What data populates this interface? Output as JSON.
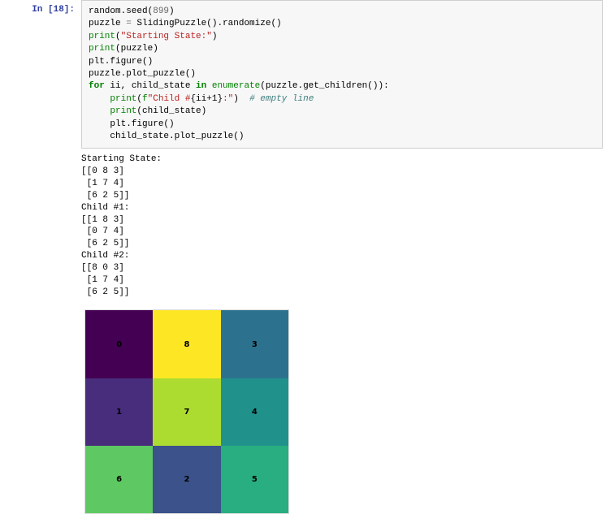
{
  "cell": {
    "in_prompt": "In [18]:",
    "run_btn_glyph": "▶",
    "code": {
      "l0_fn": "random",
      "l0_call": ".seed(",
      "l0_num": "899",
      "l0_end": ")",
      "l1": "puzzle ",
      "l1_eq": "=",
      "l1_rest": " SlidingPuzzle().randomize()",
      "l2_print": "print",
      "l2_arg": "\"Starting State:\"",
      "l3_print": "print",
      "l3_arg": "(puzzle)",
      "l4": "plt.figure()",
      "l5": "puzzle.plot_puzzle()",
      "l6_for": "for",
      "l6_mid": " ii, child_state ",
      "l6_in": "in",
      "l6_enum_sp": " ",
      "l6_enum": "enumerate",
      "l6_rest": "(puzzle.get_children()):",
      "l7_indent": "    ",
      "l7_print": "print",
      "l7_open": "(",
      "l7_affix": "f",
      "l7_str1": "\"Child #",
      "l7_brace": "{ii+1}",
      "l7_str2": ":\"",
      "l7_close": ")  ",
      "l7_comment": "# empty line",
      "l8_indent": "    ",
      "l8_print": "print",
      "l8_arg": "(child_state)",
      "l9_indent": "    ",
      "l9": "plt.figure()",
      "l10_indent": "    ",
      "l10": "child_state.plot_puzzle()"
    }
  },
  "output": {
    "text": "Starting State:\n[[0 8 3]\n [1 7 4]\n [6 2 5]]\nChild #1:\n[[1 8 3]\n [0 7 4]\n [6 2 5]]\nChild #2:\n[[8 0 3]\n [1 7 4]\n [6 2 5]]"
  },
  "chart_data": {
    "type": "heatmap",
    "title": "",
    "grid": [
      [
        0,
        8,
        3
      ],
      [
        1,
        7,
        4
      ],
      [
        6,
        2,
        5
      ]
    ],
    "labels": [
      "0",
      "8",
      "3",
      "1",
      "7",
      "4",
      "6",
      "2",
      "5"
    ],
    "colors": {
      "0": "#440154",
      "1": "#472d7b",
      "2": "#3b528b",
      "3": "#2c728e",
      "4": "#21918c",
      "5": "#28ae80",
      "6": "#5ec962",
      "7": "#addc30",
      "8": "#fde725"
    },
    "xlim": [
      0,
      3
    ],
    "ylim": [
      0,
      3
    ]
  }
}
